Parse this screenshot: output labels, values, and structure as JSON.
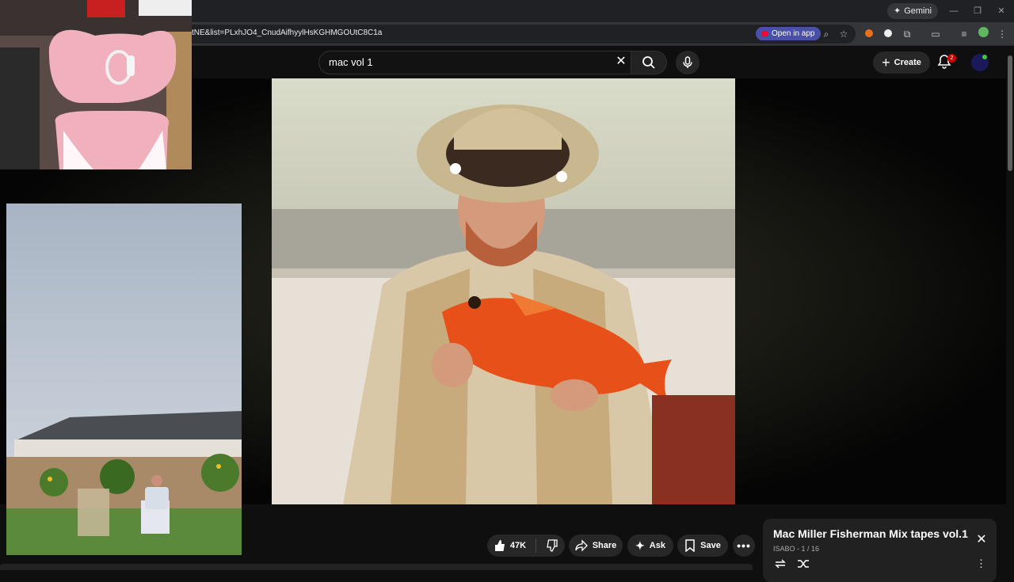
{
  "browser": {
    "gemini_label": "Gemini",
    "url": "tNE&list=PLxhJO4_CnudAifhyylHsKGHMGOUtC8C1a",
    "open_in_app_label": "Open in app"
  },
  "youtube": {
    "search": {
      "query": "mac vol 1"
    },
    "create_label": "Create",
    "notifications_count": "2"
  },
  "actions": {
    "likes": "47K",
    "share_label": "Share",
    "ask_label": "Ask",
    "save_label": "Save"
  },
  "playlist": {
    "title": "Mac Miller Fisherman Mix tapes vol.1",
    "subtitle": "ISABO - 1 / 16"
  },
  "colors": {
    "background": "#0f0f0f",
    "pill": "#272727",
    "open_in_app": "#4a4fa8",
    "notification_badge": "#cc0000",
    "fish": "#e8501a"
  }
}
